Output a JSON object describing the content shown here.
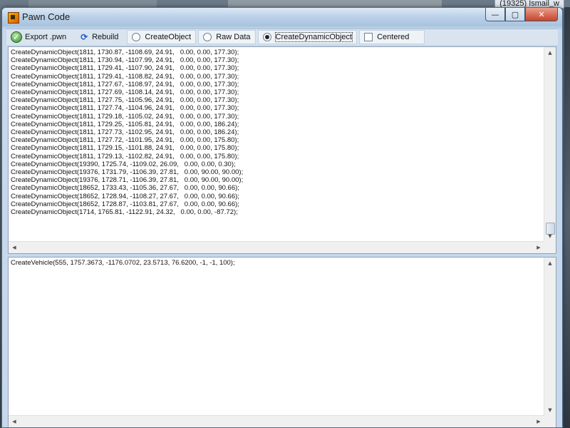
{
  "background": {
    "tag_text": "(19325) Ismail_w"
  },
  "window": {
    "title": "Pawn Code"
  },
  "caption": {
    "minimize": "—",
    "maximize": "▢",
    "close": "✕"
  },
  "toolbar": {
    "export_label": "Export .pwn",
    "rebuild_label": "Rebuild",
    "options": [
      {
        "label": "CreateObject",
        "selected": false
      },
      {
        "label": "Raw Data",
        "selected": false
      },
      {
        "label": "CreateDynamicObject",
        "selected": true
      }
    ],
    "centered_label": "Centered",
    "centered_checked": false
  },
  "icons": {
    "export": "export-icon",
    "rebuild": "refresh-icon"
  },
  "code_pane": {
    "lines": [
      "CreateDynamicObject(1811, 1730.87, -1108.69, 24.91,   0.00, 0.00, 177.30);",
      "CreateDynamicObject(1811, 1730.94, -1107.99, 24.91,   0.00, 0.00, 177.30);",
      "CreateDynamicObject(1811, 1729.41, -1107.90, 24.91,   0.00, 0.00, 177.30);",
      "CreateDynamicObject(1811, 1729.41, -1108.82, 24.91,   0.00, 0.00, 177.30);",
      "CreateDynamicObject(1811, 1727.67, -1108.97, 24.91,   0.00, 0.00, 177.30);",
      "CreateDynamicObject(1811, 1727.69, -1108.14, 24.91,   0.00, 0.00, 177.30);",
      "CreateDynamicObject(1811, 1727.75, -1105.96, 24.91,   0.00, 0.00, 177.30);",
      "CreateDynamicObject(1811, 1727.74, -1104.96, 24.91,   0.00, 0.00, 177.30);",
      "CreateDynamicObject(1811, 1729.18, -1105.02, 24.91,   0.00, 0.00, 177.30);",
      "CreateDynamicObject(1811, 1729.25, -1105.81, 24.91,   0.00, 0.00, 186.24);",
      "CreateDynamicObject(1811, 1727.73, -1102.95, 24.91,   0.00, 0.00, 186.24);",
      "CreateDynamicObject(1811, 1727.72, -1101.95, 24.91,   0.00, 0.00, 175.80);",
      "CreateDynamicObject(1811, 1729.15, -1101.88, 24.91,   0.00, 0.00, 175.80);",
      "CreateDynamicObject(1811, 1729.13, -1102.82, 24.91,   0.00, 0.00, 175.80);",
      "CreateDynamicObject(19390, 1725.74, -1109.02, 26.09,   0.00, 0.00, 0.30);",
      "CreateDynamicObject(19376, 1731.79, -1106.39, 27.81,   0.00, 90.00, 90.00);",
      "CreateDynamicObject(19376, 1728.71, -1106.39, 27.81,   0.00, 90.00, 90.00);",
      "CreateDynamicObject(18652, 1733.43, -1105.36, 27.67,   0.00, 0.00, 90.66);",
      "CreateDynamicObject(18652, 1728.94, -1108.27, 27.67,   0.00, 0.00, 90.66);",
      "CreateDynamicObject(18652, 1728.87, -1103.81, 27.67,   0.00, 0.00, 90.66);",
      "CreateDynamicObject(1714, 1765.81, -1122.91, 24.32,   0.00, 0.00, -87.72);"
    ]
  },
  "vehicle_pane": {
    "lines": [
      "CreateVehicle(555, 1757.3673, -1176.0702, 23.5713, 76.6200, -1, -1, 100);"
    ]
  }
}
